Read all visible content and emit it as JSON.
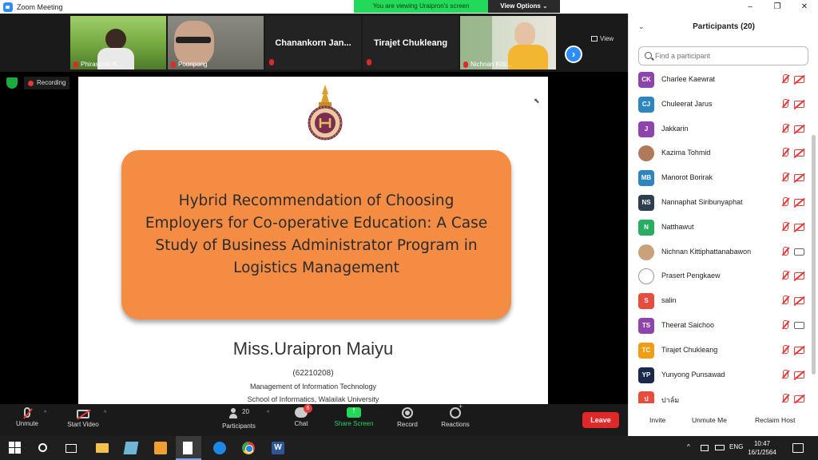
{
  "window": {
    "title": "Zoom Meeting",
    "min": "–",
    "max": "❐",
    "close": "✕"
  },
  "banner": {
    "message": "You are viewing Uraipron's screen",
    "options": "View Options ⌄"
  },
  "video_strip": {
    "tiles": [
      {
        "name": "Phirasoost K..."
      },
      {
        "name": "Poonpong"
      },
      {
        "name": "Chanankorn  Jan..."
      },
      {
        "name": "Tirajet Chukleang"
      },
      {
        "name": "Nichnan Kitti..."
      }
    ],
    "next": "›",
    "view_label": "View"
  },
  "status": {
    "recording": "Recording"
  },
  "slide": {
    "title": "Hybrid Recommendation of Choosing Employers for Co-operative Education: A Case Study of Business Administrator Program in Logistics Management",
    "presenter": "Miss.Uraipron Maiyu",
    "student_id": "(62210208)",
    "department": "Management of Information Technology",
    "school": "School of Informatics, Walailak University"
  },
  "toolbar": {
    "unmute": "Unmute",
    "start_video": "Start Video",
    "participants": "Participants",
    "participants_count": "20",
    "chat": "Chat",
    "chat_badge": "6",
    "share_screen": "Share Screen",
    "record": "Record",
    "reactions": "Reactions",
    "leave": "Leave",
    "caret": "^"
  },
  "panel": {
    "title": "Participants (20)",
    "search_placeholder": "Find a participant",
    "participants": [
      {
        "initials": "CK",
        "name": "Charlee Kaewrat",
        "color": "#8e44ad",
        "video": "off"
      },
      {
        "initials": "CJ",
        "name": "Chuleerat Jarus",
        "color": "#2e86c1",
        "video": "off"
      },
      {
        "initials": "J",
        "name": "Jakkarin",
        "color": "#8e44ad",
        "video": "off"
      },
      {
        "initials": "",
        "name": "Kazima Tohmid",
        "color": "#b07a5a",
        "video": "off"
      },
      {
        "initials": "MB",
        "name": "Manorot Borirak",
        "color": "#2e86c1",
        "video": "off"
      },
      {
        "initials": "NS",
        "name": "Nannaphat Siribunyaphat",
        "color": "#2c3e50",
        "video": "off"
      },
      {
        "initials": "N",
        "name": "Natthawut",
        "color": "#27ae60",
        "video": "off"
      },
      {
        "initials": "",
        "name": "Nichnan Kittiphattanabawon",
        "color": "#c9a27a",
        "video": "on"
      },
      {
        "initials": "",
        "name": "Prasert Pengkaew",
        "color": "#ffffff",
        "video": "off"
      },
      {
        "initials": "S",
        "name": "salin",
        "color": "#e74c3c",
        "video": "off"
      },
      {
        "initials": "TS",
        "name": "Theerat Saichoo",
        "color": "#8e44ad",
        "video": "on"
      },
      {
        "initials": "TC",
        "name": "Tirajet Chukleang",
        "color": "#f39c12",
        "video": "off"
      },
      {
        "initials": "YP",
        "name": "Yunyong Punsawad",
        "color": "#1b2a4a",
        "video": "off"
      },
      {
        "initials": "ป",
        "name": "ปาล์ม",
        "color": "#e74c3c",
        "video": "off"
      }
    ],
    "invite": "Invite",
    "unmute_me": "Unmute Me",
    "reclaim_host": "Reclaim Host"
  },
  "taskbar": {
    "word_label": "W",
    "tray_arrow": "^",
    "language": "ENG",
    "time": "10:47",
    "date": "16/1/2564"
  }
}
